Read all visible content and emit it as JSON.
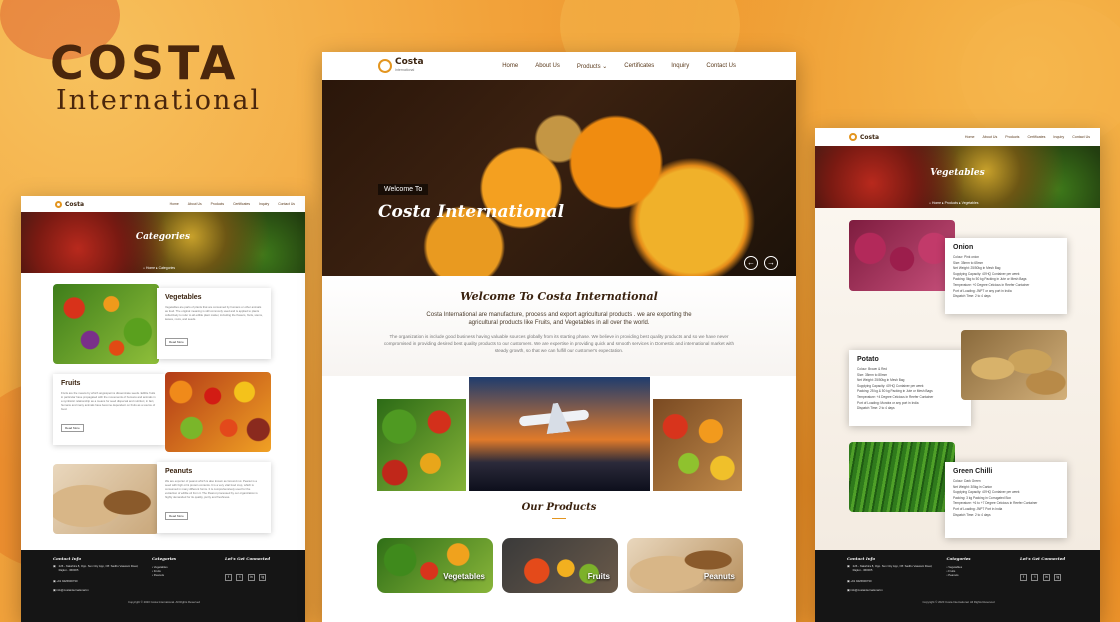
{
  "brand": {
    "line1": "COSTA",
    "line2": "International"
  },
  "nav": {
    "logo_text": "Costa",
    "logo_sub": "International",
    "items": [
      "Home",
      "About Us",
      "Products",
      "Certificates",
      "Inquiry",
      "Contact Us"
    ]
  },
  "hero": {
    "welcome": "Welcome To",
    "title": "Costa International",
    "prev_icon": "arrow-left-icon",
    "next_icon": "arrow-right-icon"
  },
  "about": {
    "heading": "Welcome To Costa International",
    "lead": "Costa International are manufacture, process and export agricultural products . we are exporting the agricultural products like Fruits, and Vegetables in all over the world.",
    "body": "The organization is include good business having valuable sources globally from its starting phase. We believe in providing best quality products and so we have never compromised in providing desired best quality products to our customers. We are expertise in providing quick and smooth services in Domestic and international market with steady growth, so that we can fulfill our customer's expectation."
  },
  "products": {
    "heading": "Our Products",
    "items": [
      "Vegetables",
      "Fruits",
      "Peanuts"
    ]
  },
  "categories_page": {
    "banner": "Categories",
    "crumb_home": "Home",
    "crumb_current": "Categories",
    "cards": [
      {
        "title": "Vegetables",
        "text": "Vegetables are parts of plants that are consumed by humans or other animals as food. The original meaning is still commonly used and is applied to plants collectively to refer to all edible plant matter, including the flowers, fruits, stems, leaves, roots, and seeds.",
        "button": "Read More"
      },
      {
        "title": "Fruits",
        "text": "Fruits are the means by which angiosperms disseminate seeds. Edible fruits in particular have propagated with the movements of humans and animals in a symbiotic relationship as a means for seed dispersal and nutrition; in fact, humans and many animals have become dependent on fruits as a source of food.",
        "button": "Read More"
      },
      {
        "title": "Peanuts",
        "text": "We are exporter of peanut which is also known as Ground nut. Peanut is a seed with high oil & protein contents. It is a very vital food crop, which is consumed in many different forms. It is comprehensively used for the extraction of edible oil from it. The Peanut processed by our organization is highly demanded for its quality, purity and freshness.",
        "button": "Read More"
      }
    ]
  },
  "vegetables_page": {
    "banner": "Vegetables",
    "crumb_home": "Home",
    "crumb_mid": "Products",
    "crumb_current": "Vegetables",
    "items": [
      {
        "name": "Onion",
        "specs": [
          "Colour: Pink onion",
          "Size: 35mm to 65mm",
          "Net Weight: 25/50kg in Mesh Bag",
          "Supplying Capacity: 40'HQ Container per week",
          "Packing: 5kg to 50 kg Packing in Jute or Mesh Bags",
          "Temperature: +0 Degree Celcious in Reefer Container",
          "Port of Loading: JNPT or any port in India",
          "Dispatch Time: 2 to 4 days"
        ]
      },
      {
        "name": "Potato",
        "specs": [
          "Colour: Brown & Red",
          "Size: 35mm to 80mm",
          "Net Weight: 25/50kg in Mesh Bag",
          "Supplying Capacity: 40'HQ Container per week",
          "Packing: 25 kg & 50 kg Packing in Jute or Mesh Bags",
          "Temperature: +4 Degree Celcious in Reefer Container",
          "Port of Loading: Mundra or any port in India",
          "Dispatch Time: 2 to 4 days"
        ]
      },
      {
        "name": "Green Chilli",
        "specs": [
          "Colour: Dark Green",
          "Net Weight: 3/5kg in Carton",
          "Supplying Capacity: 40'HQ Container per week",
          "Packing: 3 kg Packing in Corrugated Box",
          "Temperature: +6 to +7 Degree Celcious in Reefer Container",
          "Port of Loading: JNPT Port in India",
          "Dispatch Time: 2 to 4 days"
        ]
      }
    ]
  },
  "footer": {
    "contact_h": "Contact Info",
    "address": "226 - Nakshtra 8, Opp. Sun City App, Off. Sadhu Vaswani Road, Rajkot - 360005",
    "phone": "+91 9426900730",
    "email": "info@costainternational.in",
    "categories_h": "Categories",
    "categories": [
      "Vegetables",
      "Fruits",
      "Peanuts"
    ],
    "connect_h": "Let's Get Connected",
    "socials": [
      "f",
      "t",
      "in",
      "ig"
    ],
    "copyright": "Copyright © 2020 Costa International. All Rights Reserved"
  }
}
